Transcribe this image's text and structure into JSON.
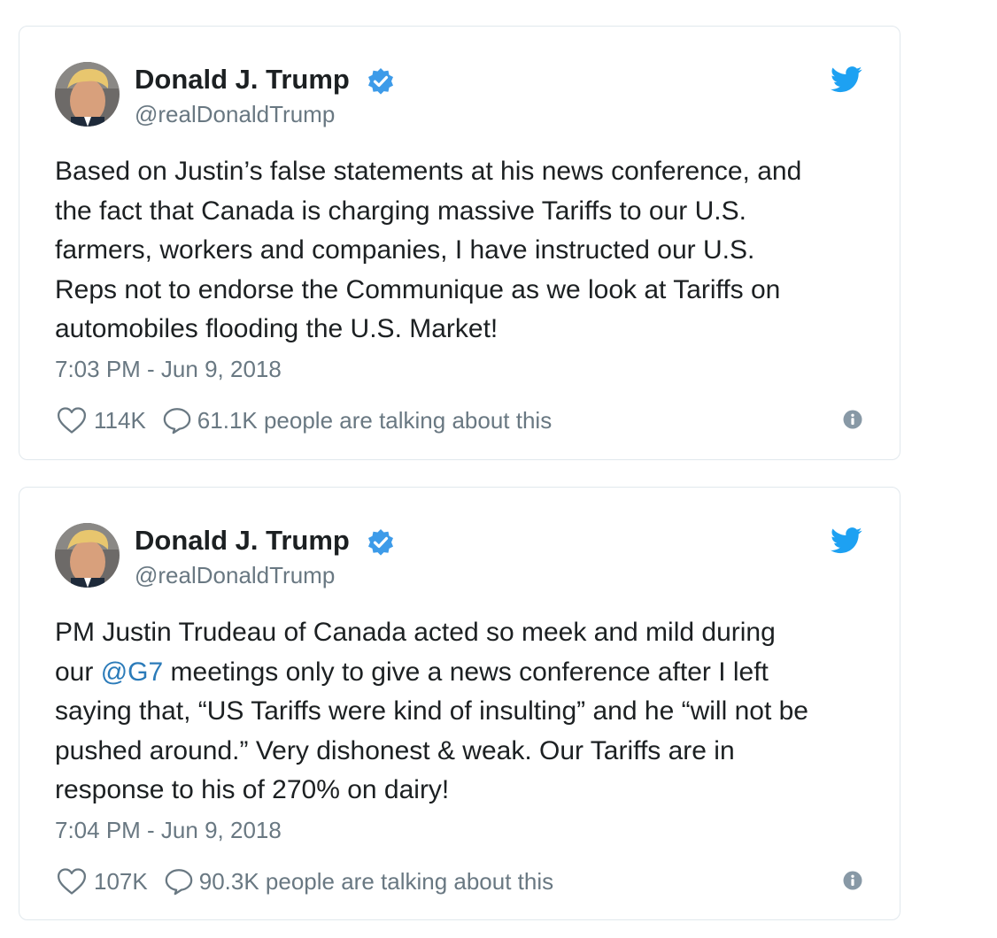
{
  "tweets": [
    {
      "author_name": "Donald J. Trump",
      "author_handle": "@realDonaldTrump",
      "text_lines": [
        "Based on Justin’s false statements at his news conference, and",
        "the fact that Canada is charging massive Tariffs to our U.S.",
        "farmers, workers and companies, I have instructed our U.S.",
        "Reps not to endorse the Communique as we look at Tariffs on",
        "automobiles flooding the U.S. Market!"
      ],
      "timestamp": "7:03 PM - Jun 9, 2018",
      "likes": "114K",
      "talking": "61.1K people are talking about this"
    },
    {
      "author_name": "Donald J. Trump",
      "author_handle": "@realDonaldTrump",
      "text_lines": [
        "PM Justin Trudeau of Canada acted so meek and mild during",
        {
          "before": "our ",
          "mention": "@G7",
          "after": " meetings only to give a news conference after I left"
        },
        "saying that, “US Tariffs were kind of insulting” and he “will not be",
        "pushed around.” Very dishonest & weak. Our Tariffs are in",
        "response to his of 270% on dairy!"
      ],
      "timestamp": "7:04 PM - Jun 9, 2018",
      "likes": "107K",
      "talking": "90.3K people are talking about this"
    }
  ],
  "colors": {
    "twitter_blue": "#1da1f2",
    "verified_blue": "#3d9be9",
    "link_blue": "#2b7bb9",
    "secondary_text": "#697882",
    "card_border": "#e1e8ed"
  },
  "icons": [
    "avatar",
    "verified-badge-icon",
    "twitter-bird-icon",
    "heart-icon",
    "reply-bubble-icon",
    "info-icon"
  ]
}
